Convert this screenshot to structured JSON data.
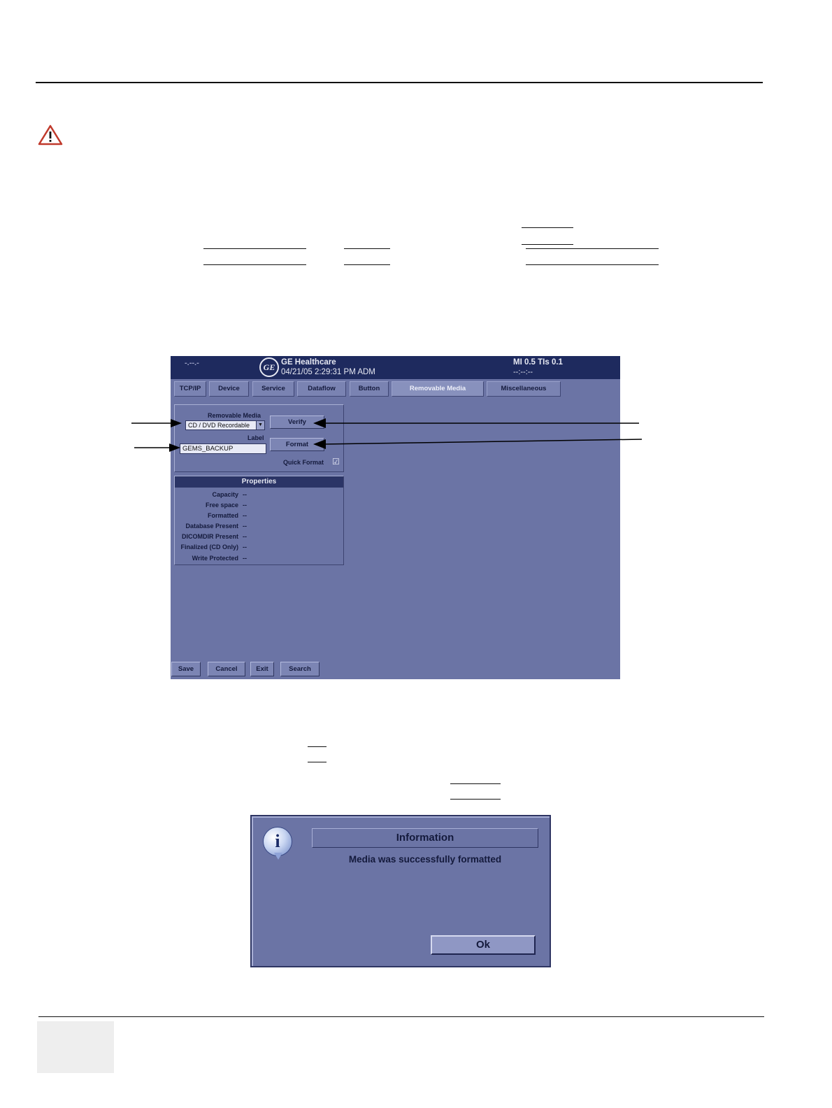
{
  "screen": {
    "topbar": {
      "dash": "-.--.-",
      "brand": "GE Healthcare",
      "datetime": "04/21/05 2:29:31 PM  ADM",
      "mi_tis": "MI 0.5   TIs 0.1",
      "status": "--:--:--"
    },
    "tabs": [
      {
        "label": "TCP/IP"
      },
      {
        "label": "Device"
      },
      {
        "label": "Service"
      },
      {
        "label": "Dataflow"
      },
      {
        "label": "Button"
      },
      {
        "label": "Removable Media"
      },
      {
        "label": "Miscellaneous"
      }
    ],
    "media_panel": {
      "removable_media_label": "Removable Media",
      "media_select_value": "CD / DVD Recordable",
      "verify_label": "Verify",
      "label_heading": "Label",
      "label_value": "GEMS_BACKUP",
      "format_label": "Format",
      "quick_format_label": "Quick Format",
      "quick_format_checked": "☑"
    },
    "properties": {
      "header": "Properties",
      "rows": [
        {
          "label": "Capacity",
          "value": "--"
        },
        {
          "label": "Free space",
          "value": "--"
        },
        {
          "label": "Formatted",
          "value": "--"
        },
        {
          "label": "Database Present",
          "value": "--"
        },
        {
          "label": "DICOMDIR Present",
          "value": "--"
        },
        {
          "label": "Finalized (CD Only)",
          "value": "--"
        },
        {
          "label": "Write Protected",
          "value": "--"
        }
      ]
    },
    "bottom_buttons": [
      {
        "label": "Save"
      },
      {
        "label": "Cancel"
      },
      {
        "label": "Exit"
      },
      {
        "label": "Search"
      }
    ]
  },
  "dialog": {
    "title": "Information",
    "message": "Media was successfully formatted",
    "ok_label": "Ok",
    "icon": "info-icon"
  },
  "colors": {
    "screen_bg": "#6b74a5",
    "topbar_bg": "#1e2a5e",
    "warning": "#c0392b"
  }
}
